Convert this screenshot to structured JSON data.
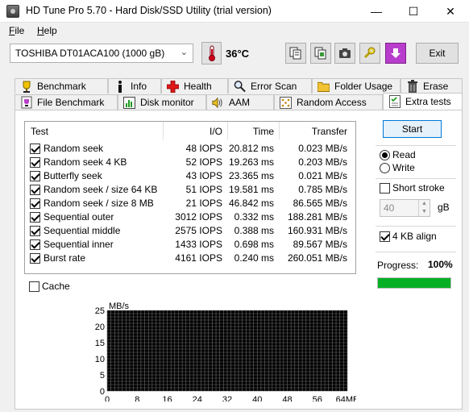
{
  "window": {
    "title": "HD Tune Pro 5.70 - Hard Disk/SSD Utility (trial version)",
    "minimize": "—",
    "maximize": "☐",
    "close": "✕"
  },
  "menu": {
    "file": "File",
    "help": "Help",
    "file_accel": "F",
    "help_accel": "H"
  },
  "toolbar": {
    "drive": "TOSHIBA DT01ACA100 (1000 gB)",
    "temperature": "36°C",
    "exit": "Exit"
  },
  "tabs_top": [
    "Benchmark",
    "Info",
    "Health",
    "Error Scan",
    "Folder Usage",
    "Erase"
  ],
  "tabs_bottom": [
    "File Benchmark",
    "Disk monitor",
    "AAM",
    "Random Access",
    "Extra tests"
  ],
  "active_tab": "Extra tests",
  "results": {
    "headers": {
      "test": "Test",
      "io": "I/O",
      "time": "Time",
      "transfer": "Transfer"
    },
    "rows": [
      {
        "test": "Random seek",
        "io": "48 IOPS",
        "time": "20.812 ms",
        "transfer": "0.023 MB/s",
        "checked": true
      },
      {
        "test": "Random seek 4 KB",
        "io": "52 IOPS",
        "time": "19.263 ms",
        "transfer": "0.203 MB/s",
        "checked": true
      },
      {
        "test": "Butterfly seek",
        "io": "43 IOPS",
        "time": "23.365 ms",
        "transfer": "0.021 MB/s",
        "checked": true
      },
      {
        "test": "Random seek / size 64 KB",
        "io": "51 IOPS",
        "time": "19.581 ms",
        "transfer": "0.785 MB/s",
        "checked": true
      },
      {
        "test": "Random seek / size 8 MB",
        "io": "21 IOPS",
        "time": "46.842 ms",
        "transfer": "86.565 MB/s",
        "checked": true
      },
      {
        "test": "Sequential outer",
        "io": "3012 IOPS",
        "time": "0.332 ms",
        "transfer": "188.281 MB/s",
        "checked": true
      },
      {
        "test": "Sequential middle",
        "io": "2575 IOPS",
        "time": "0.388 ms",
        "transfer": "160.931 MB/s",
        "checked": true
      },
      {
        "test": "Sequential inner",
        "io": "1433 IOPS",
        "time": "0.698 ms",
        "transfer": "89.567 MB/s",
        "checked": true
      },
      {
        "test": "Burst rate",
        "io": "4161 IOPS",
        "time": "0.240 ms",
        "transfer": "260.051 MB/s",
        "checked": true
      }
    ]
  },
  "controls": {
    "start": "Start",
    "read": "Read",
    "write": "Write",
    "mode": "read",
    "short_stroke": "Short stroke",
    "short_stroke_checked": false,
    "stroke_value": "40",
    "stroke_unit": "gB",
    "align": "4 KB align",
    "align_checked": true,
    "progress_label": "Progress:",
    "progress_text": "100%",
    "progress_value": 1.0,
    "cache": "Cache",
    "cache_checked": false
  },
  "chart_data": {
    "type": "line",
    "ylabel": "MB/s",
    "xunit": "MB",
    "yticks": [
      0,
      5,
      10,
      15,
      20,
      25
    ],
    "xticks": [
      0,
      8,
      16,
      24,
      32,
      40,
      48,
      56,
      64
    ],
    "xlim": [
      0,
      64
    ],
    "ylim": [
      0,
      25
    ],
    "grid": true,
    "series": [],
    "colors": {
      "background": "#000000",
      "grid": "#6a6a6a"
    }
  },
  "colors": {
    "progress": "#06b025",
    "start_border": "#0078d7",
    "thermometer": "#d0021b",
    "purple_button": "#b83dcc"
  }
}
